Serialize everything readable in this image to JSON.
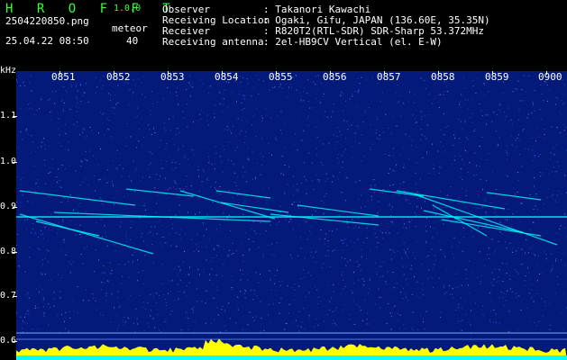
{
  "app": {
    "logo": "H R O F F T",
    "version": "1.0.0"
  },
  "file": {
    "name": "2504220850.png",
    "datetime": "25.04.22 08:50"
  },
  "meteor": {
    "label": "meteor",
    "count": "40"
  },
  "info": [
    {
      "key": "Observer",
      "value": ": Takanori Kawachi"
    },
    {
      "key": "Receiving Location",
      "value": ": Ogaki, Gifu, JAPAN (136.60E, 35.35N)"
    },
    {
      "key": "Receiver",
      "value": ": R820T2(RTL-SDR) SDR-Sharp 53.372MHz"
    },
    {
      "key": "Receiving antenna",
      "value": ": 2el-HB9CV Vertical (el. E-W)"
    }
  ],
  "axis": {
    "y_unit": "kHz",
    "y_ticks": [
      "1.1",
      "1.0",
      "0.9",
      "0.8",
      "0.7",
      "0.6"
    ],
    "x_ticks": [
      "0851",
      "0852",
      "0853",
      "0854",
      "0855",
      "0856",
      "0857",
      "0858",
      "0859",
      "0900"
    ]
  },
  "colors": {
    "background": "#000000",
    "plot": "#031a7a",
    "trace": "#00ffff",
    "echo": "#ffff00",
    "text": "#ffffff",
    "logo": "#33ff33"
  }
}
